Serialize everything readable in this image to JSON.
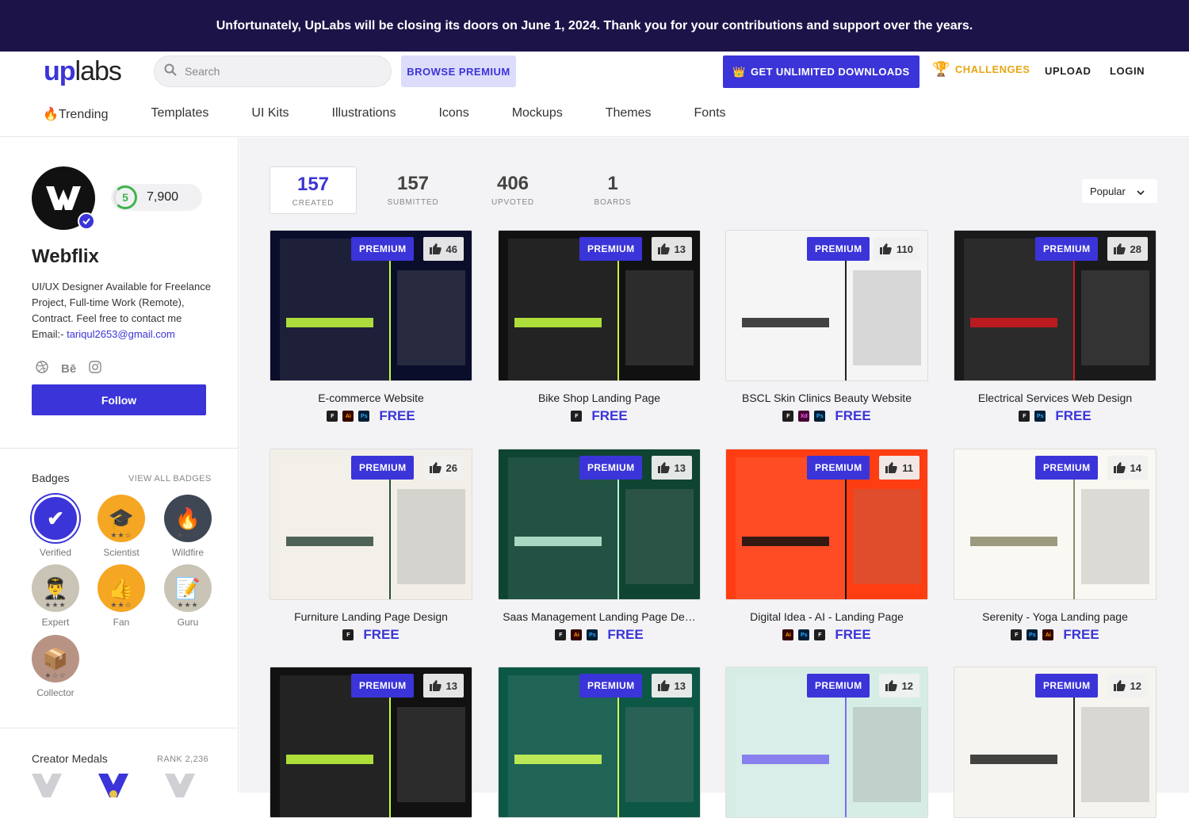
{
  "banner": {
    "text": "Unfortunately, UpLabs will be closing its doors on June 1, 2024. Thank you for your contributions and support over the years."
  },
  "header": {
    "logo_up": "up",
    "logo_labs": "labs",
    "search_placeholder": "Search",
    "browse_premium": "BROWSE PREMIUM",
    "unlimited": "GET UNLIMITED DOWNLOADS",
    "challenges": "CHALLENGES",
    "upload": "UPLOAD",
    "login": "LOGIN",
    "nav": [
      "🔥Trending",
      "Templates",
      "UI Kits",
      "Illustrations",
      "Icons",
      "Mockups",
      "Themes",
      "Fonts"
    ]
  },
  "profile": {
    "level": "5",
    "points": "7,900",
    "name": "Webflix",
    "bio": "UI/UX Designer Available for Freelance Project, Full-time Work (Remote), Contract. Feel free to contact me",
    "email_label": "Email:-",
    "email": "tariqul2653@gmail.com",
    "follow": "Follow",
    "socials": [
      "dribbble-icon",
      "behance-icon",
      "instagram-icon"
    ],
    "behance_text": "Bē"
  },
  "badges": {
    "title": "Badges",
    "view_all": "VIEW ALL BADGES",
    "items": [
      {
        "label": "Verified",
        "icon": "✔",
        "color": "#3b34d8"
      },
      {
        "label": "Scientist",
        "icon": "🎓",
        "color": "#f5a623"
      },
      {
        "label": "Wildfire",
        "icon": "🔥",
        "color": "#3f4654"
      },
      {
        "label": "Expert",
        "icon": "👨‍✈️",
        "color": "#c9c4b5"
      },
      {
        "label": "Fan",
        "icon": "👍",
        "color": "#f5a623"
      },
      {
        "label": "Guru",
        "icon": "📝",
        "color": "#c9c4b5"
      },
      {
        "label": "Collector",
        "icon": "📦",
        "color": "#b89384"
      }
    ]
  },
  "medals": {
    "title": "Creator Medals",
    "rank": "RANK 2,236"
  },
  "stats": [
    {
      "num": "157",
      "cap": "CREATED"
    },
    {
      "num": "157",
      "cap": "SUBMITTED"
    },
    {
      "num": "406",
      "cap": "UPVOTED"
    },
    {
      "num": "1",
      "cap": "BOARDS"
    }
  ],
  "sort": "Popular",
  "premium_label": "PREMIUM",
  "free_label": "FREE",
  "cards": [
    {
      "title": "E-commerce Website",
      "likes": "46",
      "tools": [
        "fig",
        "ai",
        "ps"
      ],
      "bg": "#0b0e2a",
      "accent": "#c6ff3d"
    },
    {
      "title": "Bike Shop Landing Page",
      "likes": "13",
      "tools": [
        "fig"
      ],
      "bg": "#111111",
      "accent": "#c6ff3d"
    },
    {
      "title": "BSCL Skin Clinics Beauty Website",
      "likes": "110",
      "tools": [
        "fig",
        "xd",
        "ps"
      ],
      "bg": "#f5f5f5",
      "accent": "#222222"
    },
    {
      "title": "Electrical Services Web Design",
      "likes": "28",
      "tools": [
        "fig",
        "ps"
      ],
      "bg": "#1a1a1a",
      "accent": "#d4191f"
    },
    {
      "title": "Furniture Landing Page Design",
      "likes": "26",
      "tools": [
        "fig"
      ],
      "bg": "#f2efe9",
      "accent": "#2f4a3c"
    },
    {
      "title": "Saas Management Landing Page De…",
      "likes": "13",
      "tools": [
        "fig",
        "ai",
        "ps"
      ],
      "bg": "#0f4433",
      "accent": "#bff0d8"
    },
    {
      "title": "Digital Idea - AI - Landing Page",
      "likes": "11",
      "tools": [
        "ai",
        "ps",
        "fig"
      ],
      "bg": "#ff3d12",
      "accent": "#111111"
    },
    {
      "title": "Serenity - Yoga Landing page",
      "likes": "14",
      "tools": [
        "fig",
        "ps",
        "ai"
      ],
      "bg": "#faf8f2",
      "accent": "#8a8a6a"
    },
    {
      "title": "",
      "likes": "13",
      "tools": [],
      "bg": "#111111",
      "accent": "#c6ff3d"
    },
    {
      "title": "",
      "likes": "13",
      "tools": [],
      "bg": "#0d5747",
      "accent": "#d6ff57"
    },
    {
      "title": "",
      "likes": "12",
      "tools": [],
      "bg": "#d6ede6",
      "accent": "#7a6cf0"
    },
    {
      "title": "",
      "likes": "12",
      "tools": [],
      "bg": "#f6f4ef",
      "accent": "#222222"
    }
  ]
}
